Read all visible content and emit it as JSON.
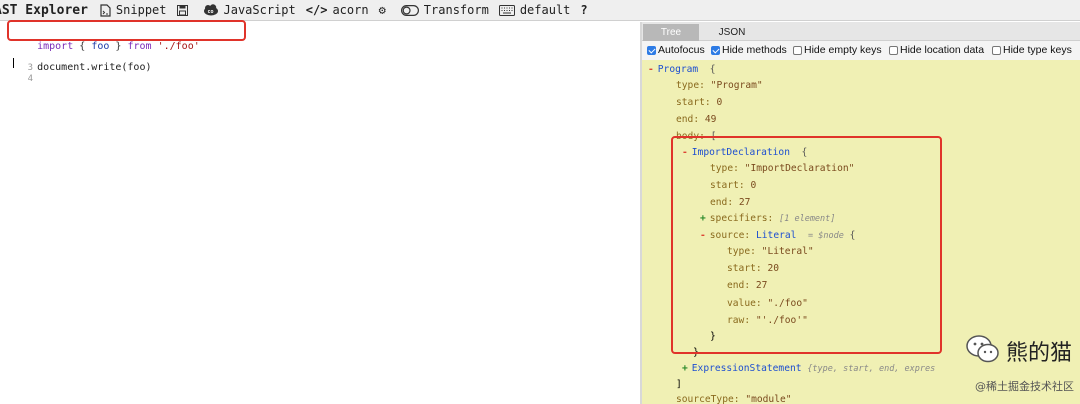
{
  "toolbar": {
    "brand": "AST Explorer",
    "snippet": "Snippet",
    "language": "JavaScript",
    "parser": "acorn",
    "transform": "Transform",
    "keymap": "default",
    "help": "?"
  },
  "editor": {
    "lines": [
      {
        "num": "",
        "import_kw": "import",
        "brace_open": "{",
        "ident": "foo",
        "brace_close": "}",
        "from_kw": "from",
        "source": "'./foo'"
      },
      {
        "num": "3",
        "text": "document.write(foo)"
      },
      {
        "num": "4",
        "text": ""
      }
    ]
  },
  "output": {
    "tabs": [
      "Tree",
      "JSON"
    ],
    "options": [
      {
        "label": "Autofocus",
        "checked": true
      },
      {
        "label": "Hide methods",
        "checked": true
      },
      {
        "label": "Hide empty keys",
        "checked": false
      },
      {
        "label": "Hide location data",
        "checked": false
      },
      {
        "label": "Hide type keys",
        "checked": false
      }
    ],
    "tree": {
      "program": {
        "toggle": "-",
        "name": "Program",
        "brace": "{",
        "type_key": "type:",
        "type_val": "\"Program\"",
        "start_key": "start:",
        "start_val": "0",
        "end_key": "end:",
        "end_val": "49",
        "body_key": "body:",
        "body_brace": "["
      },
      "import": {
        "toggle": "-",
        "name": "ImportDeclaration",
        "brace": "{",
        "type_key": "type:",
        "type_val": "\"ImportDeclaration\"",
        "start_key": "start:",
        "start_val": "0",
        "end_key": "end:",
        "end_val": "27",
        "spec_toggle": "+",
        "spec_key": "specifiers:",
        "spec_summary": "[1 element]",
        "src_toggle": "-",
        "src_key": "source:",
        "src_type": "Literal",
        "src_hint": "= $node",
        "src_brace": "{",
        "close_brace": "}"
      },
      "literal": {
        "type_key": "type:",
        "type_val": "\"Literal\"",
        "start_key": "start:",
        "start_val": "20",
        "end_key": "end:",
        "end_val": "27",
        "value_key": "value:",
        "value_val": "\"./foo\"",
        "raw_key": "raw:",
        "raw_val": "\"'./foo'\"",
        "close_brace": "}"
      },
      "expr": {
        "toggle": "+",
        "name": "ExpressionStatement",
        "summary": "{type, start, end, expres"
      },
      "body_close": "]",
      "source_type_key": "sourceType:",
      "source_type_val": "\"module\""
    }
  },
  "watermark": {
    "title": "熊的猫",
    "sub": "@稀土掘金技术社区"
  },
  "colors": {
    "highlight_box": "#e0332a",
    "tree_bg": "#f0f0b4",
    "active_tab": "#b8b8b8"
  }
}
